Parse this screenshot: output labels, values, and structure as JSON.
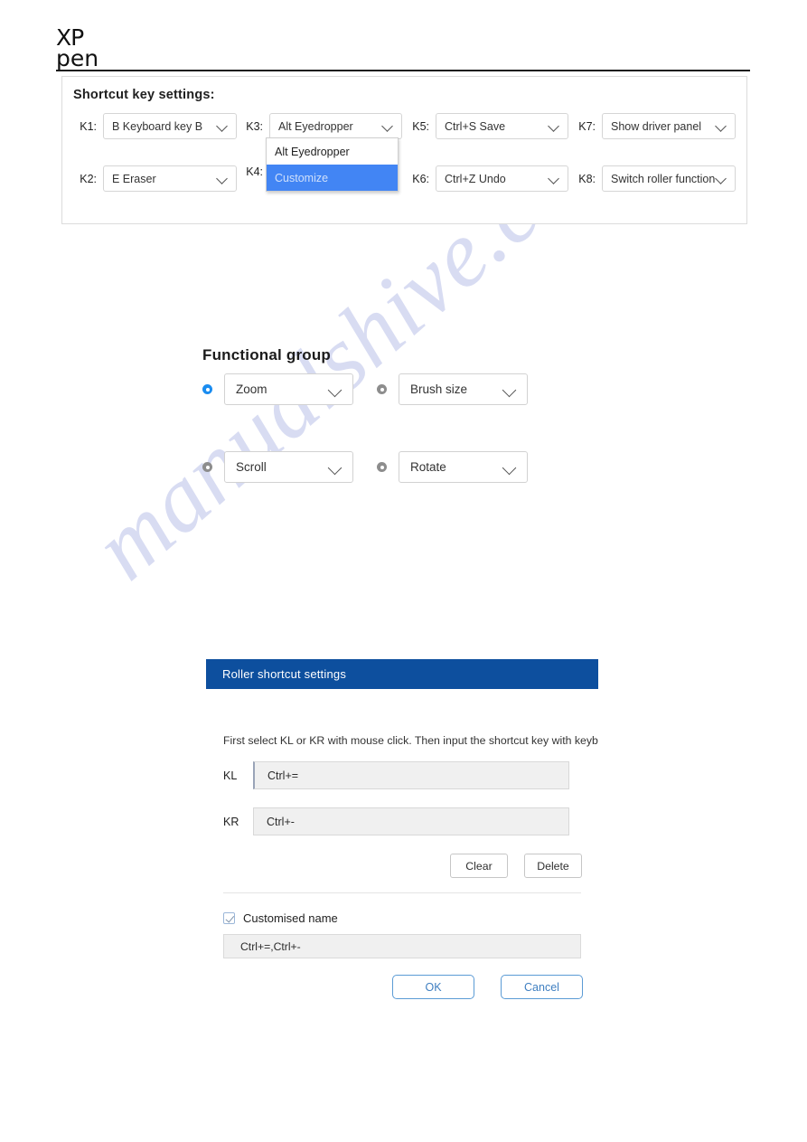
{
  "brand": {
    "logo_line1": "XP",
    "logo_line2": "pen"
  },
  "shortcut_panel": {
    "title": "Shortcut key settings:",
    "keys": [
      {
        "label": "K1:",
        "value": "B Keyboard key B"
      },
      {
        "label": "K2:",
        "value": "E Eraser"
      },
      {
        "label": "K3:",
        "value": "Alt Eyedropper"
      },
      {
        "label": "K4:",
        "value": ""
      },
      {
        "label": "K5:",
        "value": "Ctrl+S Save"
      },
      {
        "label": "K6:",
        "value": "Ctrl+Z Undo"
      },
      {
        "label": "K7:",
        "value": "Show driver panel"
      },
      {
        "label": "K8:",
        "value": "Switch roller function"
      }
    ],
    "dropdown": {
      "open_for": "K3",
      "options": [
        {
          "label": "Alt Eyedropper",
          "selected": false
        },
        {
          "label": "Customize",
          "selected": true
        }
      ],
      "highlight_color": "#4285f4"
    }
  },
  "functional_group": {
    "title": "Functional group",
    "accent_color": "#1a8cf0",
    "options": [
      {
        "label": "Zoom",
        "selected": true
      },
      {
        "label": "Brush size",
        "selected": false
      },
      {
        "label": "Scroll",
        "selected": false
      },
      {
        "label": "Rotate",
        "selected": false
      }
    ]
  },
  "roller_dialog": {
    "title": "Roller shortcut settings",
    "header_color": "#0d4f9e",
    "hint": "First select KL or KR with mouse click. Then input the shortcut key with keyboard.",
    "fields": [
      {
        "label": "KL",
        "value": "Ctrl+="
      },
      {
        "label": "KR",
        "value": "Ctrl+-"
      }
    ],
    "clear_label": "Clear",
    "delete_label": "Delete",
    "customised_name_label": "Customised name",
    "customised_name_value": "Ctrl+=,Ctrl+-",
    "ok_label": "OK",
    "cancel_label": "Cancel"
  },
  "watermark": {
    "text": "manualshive.com"
  }
}
